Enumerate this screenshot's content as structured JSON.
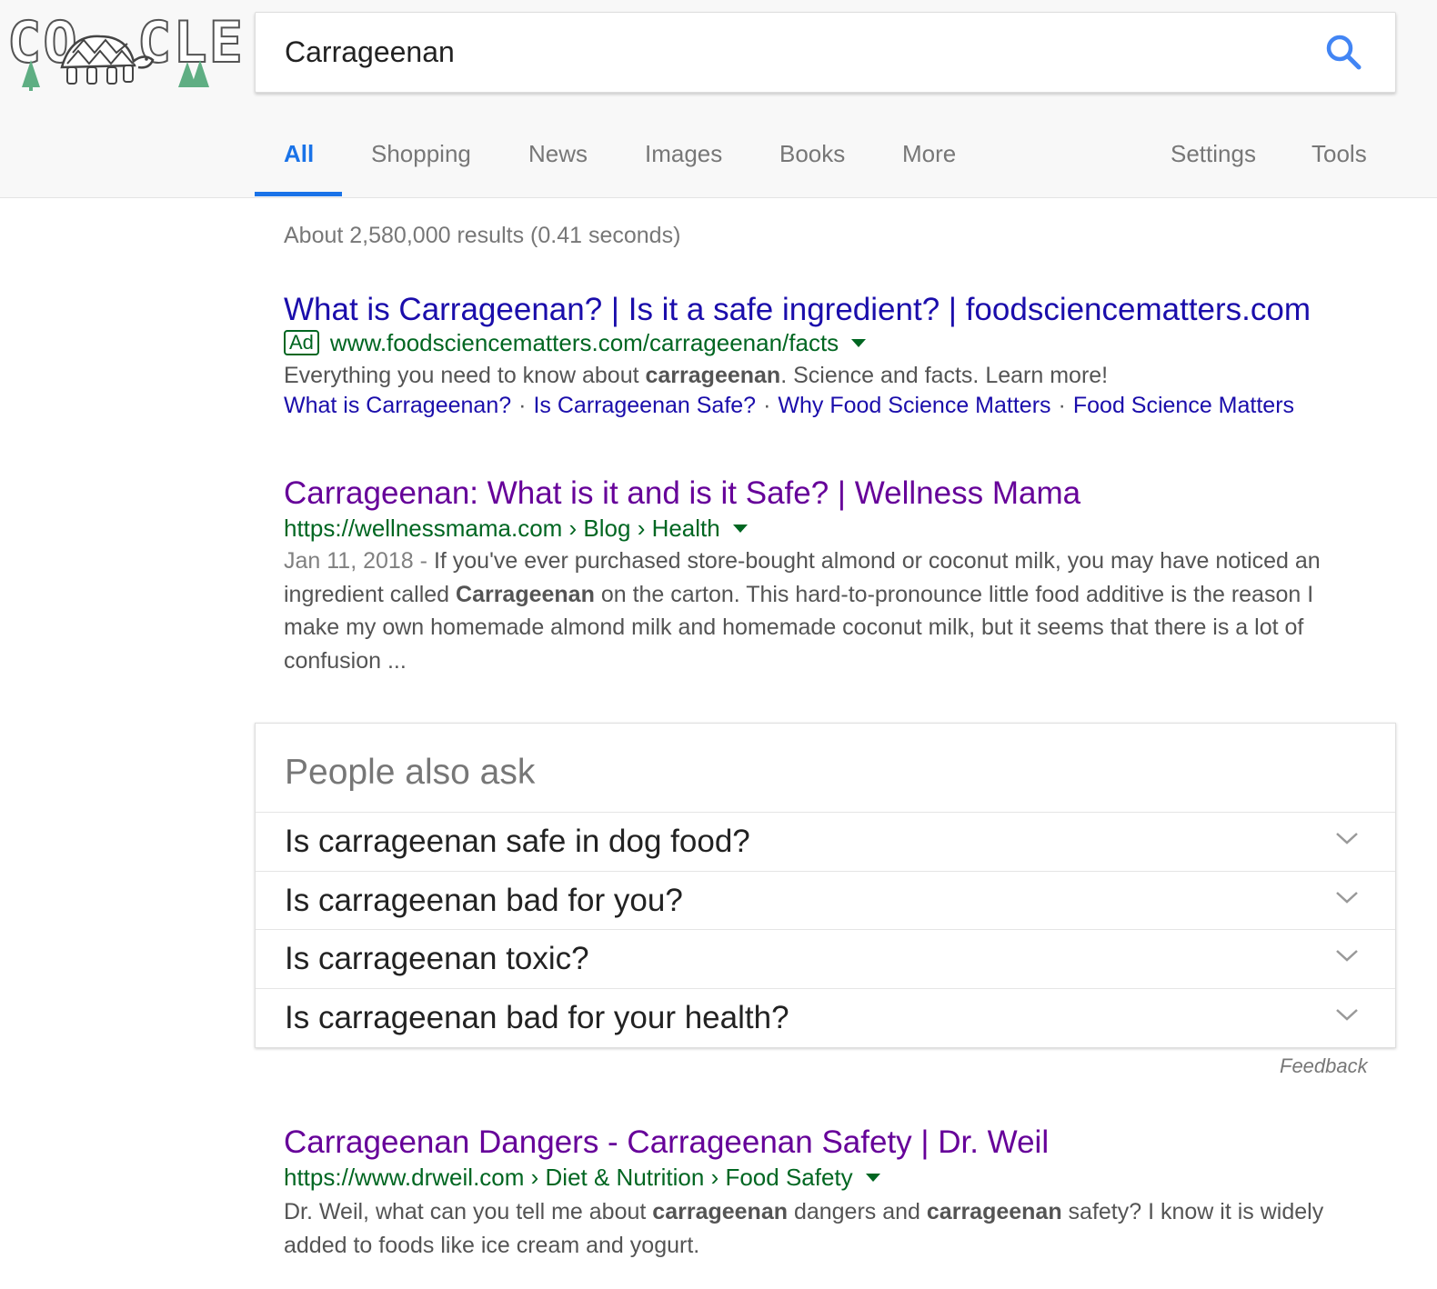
{
  "logo": {
    "left_text": "CO",
    "right_text": "CLE"
  },
  "search": {
    "query": "Carrageenan"
  },
  "tabs": [
    {
      "label": "All"
    },
    {
      "label": "Shopping"
    },
    {
      "label": "News"
    },
    {
      "label": "Images"
    },
    {
      "label": "Books"
    },
    {
      "label": "More"
    },
    {
      "label": "Settings"
    },
    {
      "label": "Tools"
    }
  ],
  "stats": "About 2,580,000 results (0.41 seconds)",
  "results": [
    {
      "title": "What is Carrageenan? | Is it a safe ingredient? | foodsciencematters.com",
      "ad_label": "Ad",
      "url": "www.foodsciencematters.com/carrageenan/facts",
      "snippet_pre": "Everything you need to know about ",
      "snippet_bold": "carrageenan",
      "snippet_post": ". Science and facts. Learn more!",
      "sitelinks": [
        "What is Carrageenan?",
        "Is Carrageenan Safe?",
        "Why Food Science Matters",
        "Food Science Matters"
      ]
    },
    {
      "title": "Carrageenan: What is it and is it Safe? | Wellness Mama",
      "url": "https://wellnessmama.com › Blog › Health",
      "date": "Jan 11, 2018 - ",
      "snippet_pre": "If you've ever purchased store-bought almond or coconut milk, you may have noticed an ingredient called ",
      "snippet_bold": "Carrageenan",
      "snippet_post": " on the carton. This hard-to-pronounce little food additive is the reason I make my own homemade almond milk and homemade coconut milk, but it seems that there is a lot of confusion ..."
    },
    {
      "title": "Carrageenan Dangers - Carrageenan Safety | Dr. Weil",
      "url": "https://www.drweil.com › Diet & Nutrition › Food Safety",
      "snippet_1": "Dr. Weil, what can you tell me about ",
      "snippet_bold_1": "carrageenan",
      "snippet_2": " dangers and ",
      "snippet_bold_2": "carrageenan",
      "snippet_3": " safety? I know it is widely added to foods like ice cream and yogurt."
    }
  ],
  "people_also_ask": {
    "title": "People also ask",
    "questions": [
      "Is carrageenan safe in dog food?",
      "Is carrageenan bad for you?",
      "Is carrageenan toxic?",
      "Is carrageenan bad for your health?"
    ]
  },
  "feedback": "Feedback",
  "colors": {
    "accent": "#1a73e8",
    "link": "#1a0dab",
    "visited": "#660099",
    "url_green": "#006621"
  }
}
